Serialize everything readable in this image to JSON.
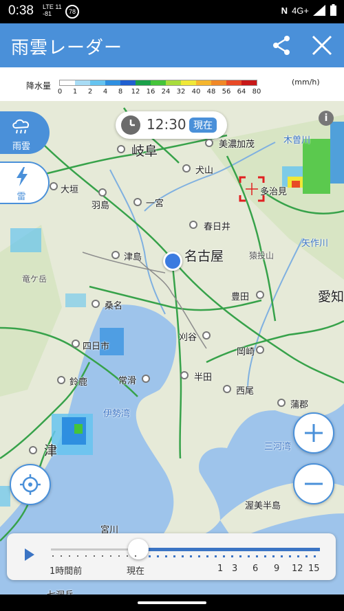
{
  "status_bar": {
    "time": "0:38",
    "network_top": "LTE 11",
    "network_bottom": "-81",
    "badge": "78",
    "nfc": "N",
    "signal_label": "4G+"
  },
  "header": {
    "title": "雨雲レーダー",
    "share_icon": "share-icon",
    "close_icon": "close-icon"
  },
  "legend": {
    "label": "降水量",
    "unit": "(mm/h)",
    "ticks": [
      "0",
      "1",
      "2",
      "4",
      "8",
      "12",
      "16",
      "24",
      "32",
      "40",
      "48",
      "56",
      "64",
      "80"
    ],
    "colors": [
      "#ffffff",
      "#a8dcf5",
      "#66c4f0",
      "#2e8fe0",
      "#1f5fd0",
      "#1aa04a",
      "#45c43a",
      "#a8dc3c",
      "#f0e838",
      "#f5b62e",
      "#f08826",
      "#e84a26",
      "#c81818"
    ]
  },
  "map": {
    "time_label": "12:30",
    "now_badge": "現在",
    "rain_button": "雨雲",
    "thunder_button": "雷",
    "info": "i",
    "places": {
      "gifu": "岐阜",
      "mino_kamo": "美濃加茂",
      "inuyama": "犬山",
      "ogaki": "大垣",
      "hashima": "羽島",
      "ichinomiya": "一宮",
      "tajimi": "多治見",
      "kasugai": "春日井",
      "tsushima": "津島",
      "nagoya": "名古屋",
      "sanageyama": "猿投山",
      "toyota": "豊田",
      "kuwana": "桑名",
      "kariya": "刈谷",
      "okazaki": "岡崎",
      "yokkaichi": "四日市",
      "tokoname": "常滑",
      "handa": "半田",
      "nishio": "西尾",
      "suzuka": "鈴鹿",
      "gamagori": "蒲郡",
      "isewan": "伊勢湾",
      "mikawawan": "三河湾",
      "tsu": "津",
      "atsumi": "渥美半島",
      "ryugatake": "竜ケ岳",
      "yahagi": "矢作川",
      "kisogawa": "木曽川",
      "aichi": "愛知",
      "miyagawa": "宮川",
      "shimoshiro": "七洞兵"
    }
  },
  "timeline": {
    "labels": {
      "one_hour_ago": "1時間前",
      "now": "現在",
      "h1": "1",
      "h3": "3",
      "h6": "6",
      "h9": "9",
      "h12": "12",
      "h15": "15"
    }
  }
}
